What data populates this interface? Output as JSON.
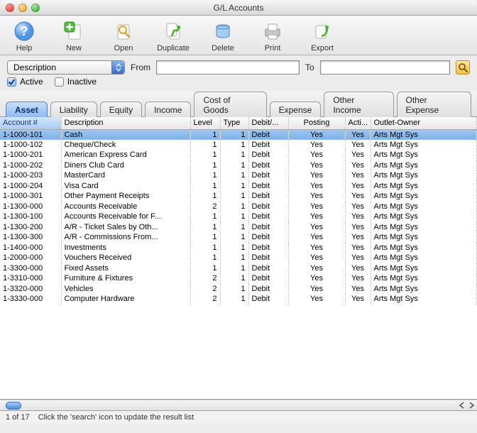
{
  "window": {
    "title": "G/L Accounts"
  },
  "toolbar": {
    "help": {
      "label": "Help"
    },
    "new": {
      "label": "New"
    },
    "open": {
      "label": "Open"
    },
    "duplicate": {
      "label": "Duplicate"
    },
    "delete": {
      "label": "Delete"
    },
    "print": {
      "label": "Print"
    },
    "export": {
      "label": "Export"
    }
  },
  "filter": {
    "field_selector": "Description",
    "from_label": "From",
    "to_label": "To",
    "from_value": "",
    "to_value": ""
  },
  "checks": {
    "active_label": "Active",
    "inactive_label": "Inactive",
    "active_checked": true,
    "inactive_checked": false
  },
  "tabs": [
    {
      "label": "Asset",
      "active": true
    },
    {
      "label": "Liability",
      "active": false
    },
    {
      "label": "Equity",
      "active": false
    },
    {
      "label": "Income",
      "active": false
    },
    {
      "label": "Cost of Goods",
      "active": false
    },
    {
      "label": "Expense",
      "active": false
    },
    {
      "label": "Other Income",
      "active": false
    },
    {
      "label": "Other Expense",
      "active": false
    }
  ],
  "columns": {
    "account": "Account #",
    "description": "Description",
    "level": "Level",
    "type": "Type",
    "debit": "Debit/...",
    "posting": "Posting",
    "active": "Acti...",
    "outlet": "Outlet-Owner"
  },
  "rows": [
    {
      "account": "1-1000-101",
      "description": "Cash",
      "level": 1,
      "type": 1,
      "debit": "Debit",
      "posting": "Yes",
      "active": "Yes",
      "outlet": "Arts Mgt Sys",
      "selected": true
    },
    {
      "account": "1-1000-102",
      "description": "Cheque/Check",
      "level": 1,
      "type": 1,
      "debit": "Debit",
      "posting": "Yes",
      "active": "Yes",
      "outlet": "Arts Mgt Sys"
    },
    {
      "account": "1-1000-201",
      "description": "American Express Card",
      "level": 1,
      "type": 1,
      "debit": "Debit",
      "posting": "Yes",
      "active": "Yes",
      "outlet": "Arts Mgt Sys"
    },
    {
      "account": "1-1000-202",
      "description": "Diners Club Card",
      "level": 1,
      "type": 1,
      "debit": "Debit",
      "posting": "Yes",
      "active": "Yes",
      "outlet": "Arts Mgt Sys"
    },
    {
      "account": "1-1000-203",
      "description": "MasterCard",
      "level": 1,
      "type": 1,
      "debit": "Debit",
      "posting": "Yes",
      "active": "Yes",
      "outlet": "Arts Mgt Sys"
    },
    {
      "account": "1-1000-204",
      "description": "Visa Card",
      "level": 1,
      "type": 1,
      "debit": "Debit",
      "posting": "Yes",
      "active": "Yes",
      "outlet": "Arts Mgt Sys"
    },
    {
      "account": "1-1000-301",
      "description": "Other Payment Receipts",
      "level": 1,
      "type": 1,
      "debit": "Debit",
      "posting": "Yes",
      "active": "Yes",
      "outlet": "Arts Mgt Sys"
    },
    {
      "account": "1-1300-000",
      "description": "Accounts Receivable",
      "level": 2,
      "type": 1,
      "debit": "Debit",
      "posting": "Yes",
      "active": "Yes",
      "outlet": "Arts Mgt Sys"
    },
    {
      "account": "1-1300-100",
      "description": "Accounts Receivable for F...",
      "level": 1,
      "type": 1,
      "debit": "Debit",
      "posting": "Yes",
      "active": "Yes",
      "outlet": "Arts Mgt Sys"
    },
    {
      "account": "1-1300-200",
      "description": "A/R - Ticket Sales by Oth...",
      "level": 1,
      "type": 1,
      "debit": "Debit",
      "posting": "Yes",
      "active": "Yes",
      "outlet": "Arts Mgt Sys"
    },
    {
      "account": "1-1300-300",
      "description": "A/R - Commissions From...",
      "level": 1,
      "type": 1,
      "debit": "Debit",
      "posting": "Yes",
      "active": "Yes",
      "outlet": "Arts Mgt Sys"
    },
    {
      "account": "1-1400-000",
      "description": "Investments",
      "level": 1,
      "type": 1,
      "debit": "Debit",
      "posting": "Yes",
      "active": "Yes",
      "outlet": "Arts Mgt Sys"
    },
    {
      "account": "1-2000-000",
      "description": "Vouchers Received",
      "level": 1,
      "type": 1,
      "debit": "Debit",
      "posting": "Yes",
      "active": "Yes",
      "outlet": "Arts Mgt Sys"
    },
    {
      "account": "1-3300-000",
      "description": "Fixed Assets",
      "level": 1,
      "type": 1,
      "debit": "Debit",
      "posting": "Yes",
      "active": "Yes",
      "outlet": "Arts Mgt Sys"
    },
    {
      "account": "1-3310-000",
      "description": "Furniture & Fixtures",
      "level": 2,
      "type": 1,
      "debit": "Debit",
      "posting": "Yes",
      "active": "Yes",
      "outlet": "Arts Mgt Sys"
    },
    {
      "account": "1-3320-000",
      "description": "Vehicles",
      "level": 2,
      "type": 1,
      "debit": "Debit",
      "posting": "Yes",
      "active": "Yes",
      "outlet": "Arts Mgt Sys"
    },
    {
      "account": "1-3330-000",
      "description": "Computer Hardware",
      "level": 2,
      "type": 1,
      "debit": "Debit",
      "posting": "Yes",
      "active": "Yes",
      "outlet": "Arts Mgt Sys"
    }
  ],
  "status": {
    "count": "1 of 17",
    "hint": "Click the 'search' icon to update the result list"
  }
}
